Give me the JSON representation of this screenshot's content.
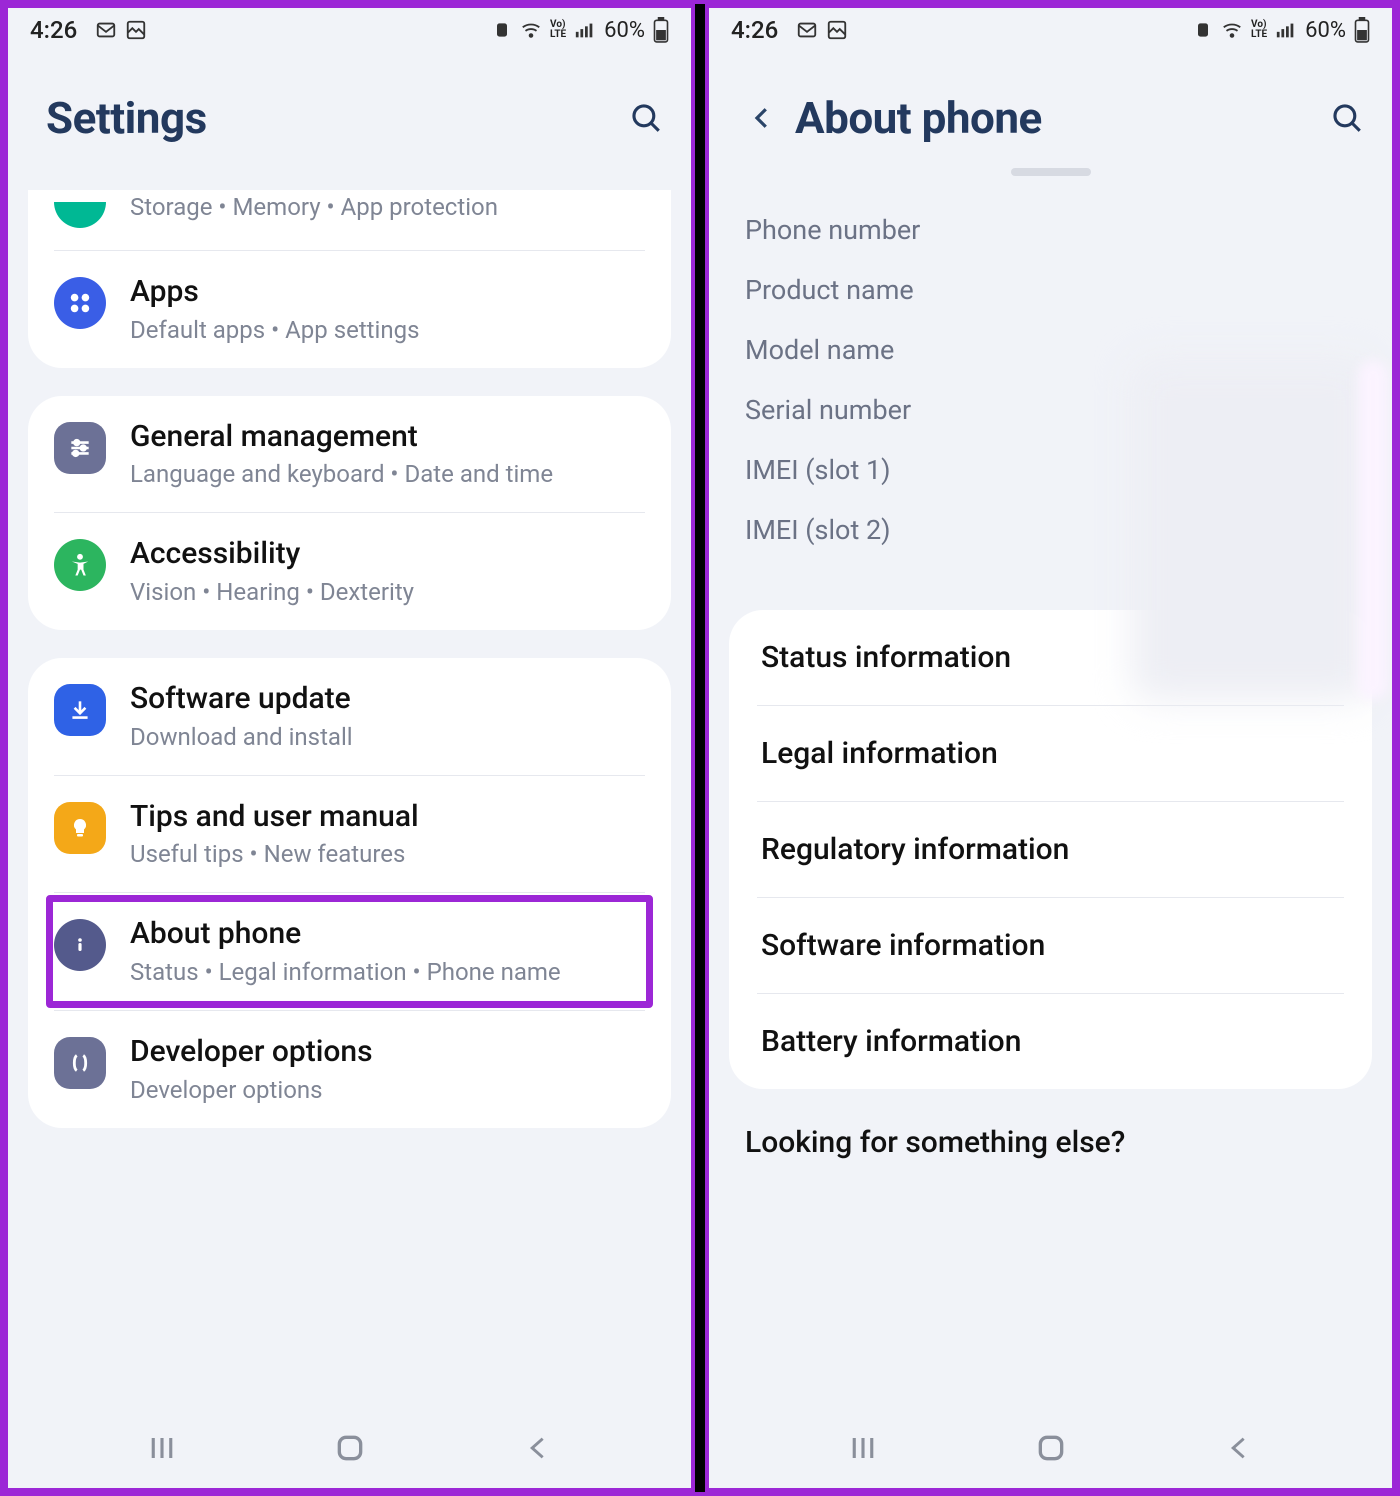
{
  "statusbar": {
    "time": "4:26",
    "battery_text": "60%"
  },
  "left": {
    "header_title": "Settings",
    "partial_sub": "Storage  •  Memory  •  App protection",
    "rows": [
      {
        "title": "Apps",
        "sub": "Default apps  •  App settings"
      }
    ],
    "group2": [
      {
        "title": "General management",
        "sub": "Language and keyboard  •  Date and time"
      },
      {
        "title": "Accessibility",
        "sub": "Vision  •  Hearing  •  Dexterity"
      }
    ],
    "group3": [
      {
        "title": "Software update",
        "sub": "Download and install"
      },
      {
        "title": "Tips and user manual",
        "sub": "Useful tips  •  New features"
      },
      {
        "title": "About phone",
        "sub": "Status  •  Legal information  •  Phone name"
      },
      {
        "title": "Developer options",
        "sub": "Developer options"
      }
    ]
  },
  "right": {
    "header_title": "About phone",
    "fields": [
      "Phone number",
      "Product name",
      "Model name",
      "Serial number",
      "IMEI (slot 1)",
      "IMEI (slot 2)"
    ],
    "items": [
      "Status information",
      "Legal information",
      "Regulatory information",
      "Software information",
      "Battery information"
    ],
    "footer": "Looking for something else?"
  }
}
